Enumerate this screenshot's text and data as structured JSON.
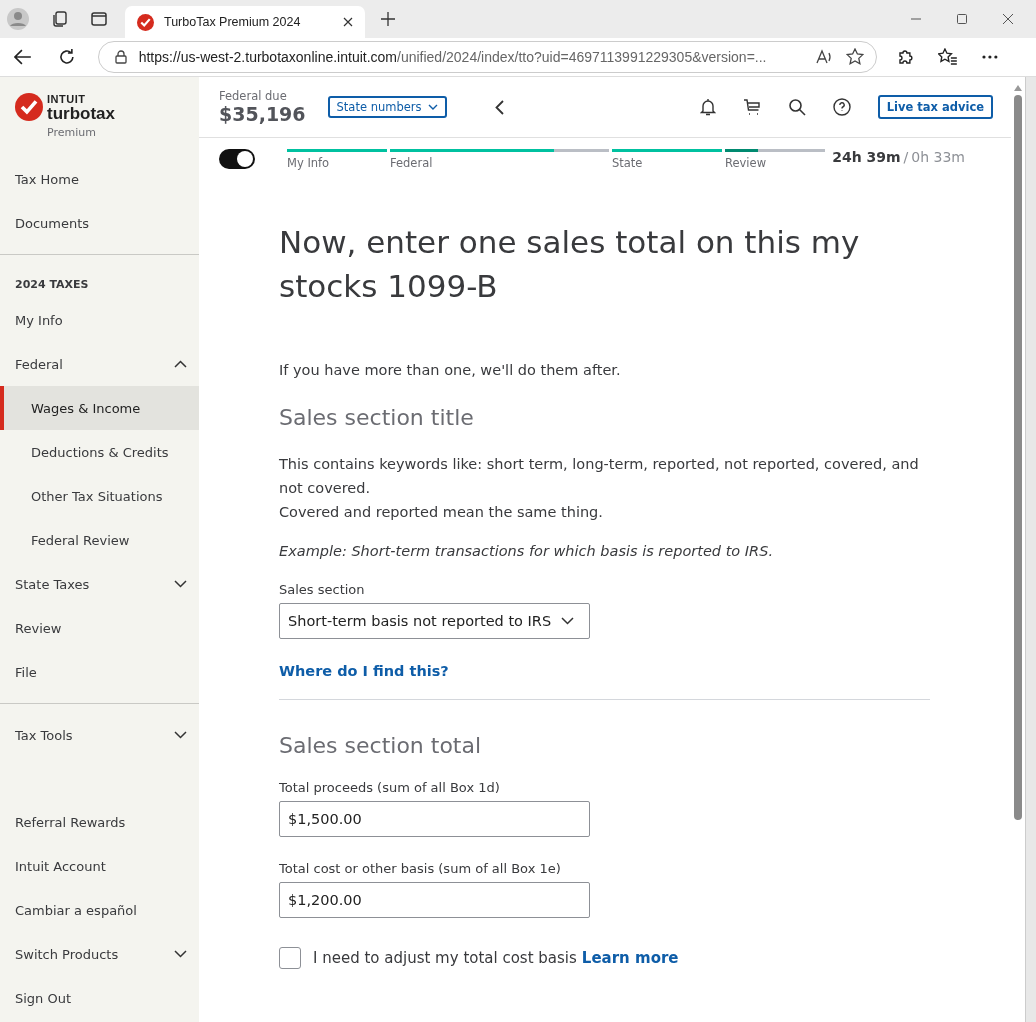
{
  "browser": {
    "tab_title": "TurboTax Premium 2024",
    "url_host": "https://us-west-2.turbotaxonline.intuit.com",
    "url_path": "/unified/2024/index/tto?uid=4697113991229305&version=..."
  },
  "logo": {
    "brand": "INTUIT",
    "product": "turbotax",
    "edition": "Premium"
  },
  "sidebar": {
    "items": [
      {
        "kind": "item",
        "label": "Tax Home",
        "selected": false
      },
      {
        "kind": "item",
        "label": "Documents",
        "selected": false
      },
      {
        "kind": "divider"
      },
      {
        "kind": "heading",
        "label": "2024 TAXES"
      },
      {
        "kind": "item",
        "label": "My Info",
        "selected": false
      },
      {
        "kind": "group",
        "label": "Federal",
        "expanded": true,
        "children": [
          {
            "label": "Wages & Income",
            "selected": true
          },
          {
            "label": "Deductions & Credits",
            "selected": false
          },
          {
            "label": "Other Tax Situations",
            "selected": false
          },
          {
            "label": "Federal Review",
            "selected": false
          }
        ]
      },
      {
        "kind": "group",
        "label": "State Taxes",
        "expanded": false
      },
      {
        "kind": "item",
        "label": "Review",
        "selected": false
      },
      {
        "kind": "item",
        "label": "File",
        "selected": false
      },
      {
        "kind": "divider"
      },
      {
        "kind": "group",
        "label": "Tax Tools",
        "expanded": false
      },
      {
        "kind": "spacer"
      },
      {
        "kind": "item",
        "label": "Referral Rewards",
        "selected": false
      },
      {
        "kind": "item",
        "label": "Intuit Account",
        "selected": false
      },
      {
        "kind": "item",
        "label": "Cambiar a español",
        "selected": false
      },
      {
        "kind": "group",
        "label": "Switch Products",
        "expanded": false
      },
      {
        "kind": "item",
        "label": "Sign Out",
        "selected": false
      }
    ]
  },
  "header": {
    "due_label": "Federal due",
    "due_amount": "$35,196",
    "state_button": "State numbers",
    "live_button": "Live tax advice"
  },
  "progress": {
    "toggle_on": true,
    "sections": [
      {
        "label": "My Info",
        "level": 1
      },
      {
        "label": "Federal",
        "level": 0.75
      },
      {
        "label": "State",
        "level": 1
      },
      {
        "label": "Review",
        "level": 0.33
      }
    ],
    "time_total": "24h 39m",
    "time_sep": "/",
    "time_spent": "0h 33m"
  },
  "content": {
    "title": "Now, enter one sales total on this my stocks 1099-B",
    "intro": "If you have more than one, we'll do them after.",
    "section_title": "Sales section title",
    "description": [
      "This contains keywords like: short term, long-term, reported, not reported, covered, and not covered.",
      "Covered and reported mean the same thing."
    ],
    "example": "Example: Short-term transactions for which basis is reported to IRS.",
    "select_label": "Sales section",
    "select_value": "Short-term basis not reported to IRS",
    "help_link": "Where do I find this?",
    "total_title": "Sales section total",
    "fields": [
      {
        "label": "Total proceeds (sum of all Box 1d)",
        "value": "$1,500.00"
      },
      {
        "label": "Total cost or other basis (sum of all Box 1e)",
        "value": "$1,200.00"
      }
    ],
    "adjust": {
      "checked": false,
      "label": "I need to adjust my total cost basis",
      "link": "Learn more"
    }
  }
}
